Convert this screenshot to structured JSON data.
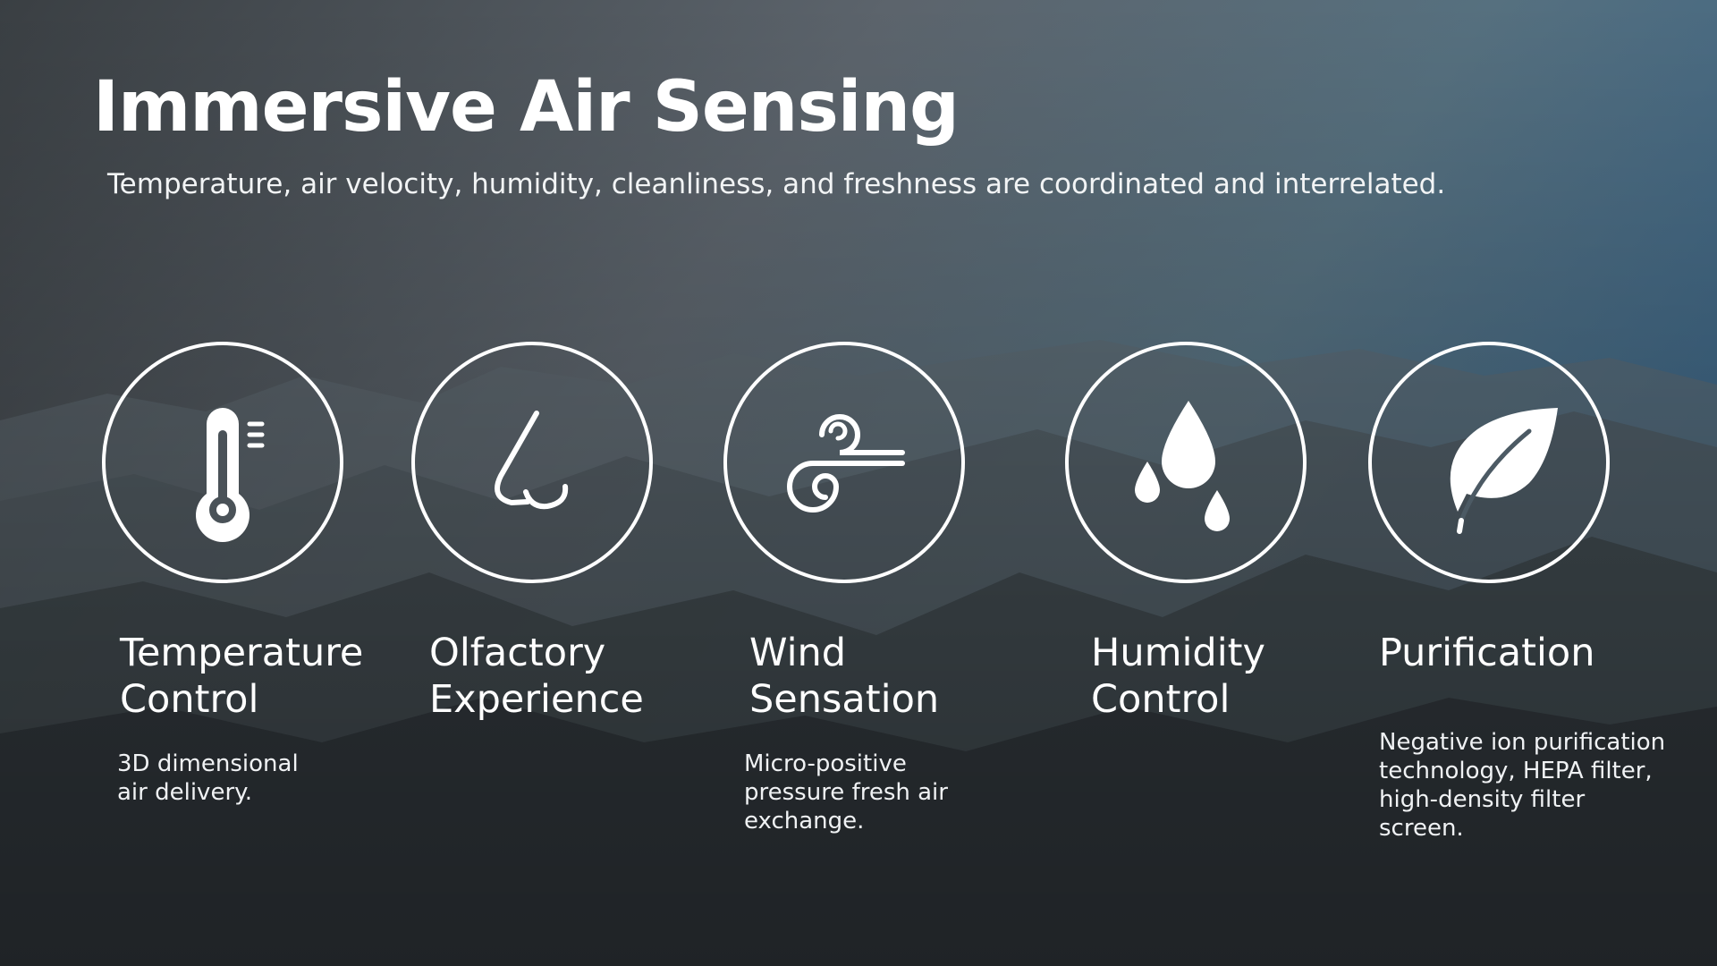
{
  "slide": {
    "title": "Immersive Air Sensing",
    "subtitle": "Temperature, air velocity, humidity, cleanliness, and freshness are coordinated and interrelated."
  },
  "features": [
    {
      "icon": "thermometer-icon",
      "label_line1": "Temperature",
      "label_line2": "Control",
      "desc_line1": "3D dimensional",
      "desc_line2": "air delivery."
    },
    {
      "icon": "nose-icon",
      "label_line1": "Olfactory",
      "label_line2": "Experience"
    },
    {
      "icon": "wind-icon",
      "label_line1": "Wind",
      "label_line2": "Sensation",
      "desc_line1": "Micro-positive",
      "desc_line2": "pressure fresh air",
      "desc_line3": "exchange."
    },
    {
      "icon": "water-drops-icon",
      "label_line1": "Humidity",
      "label_line2": "Control"
    },
    {
      "icon": "leaf-icon",
      "label_line1": "Purification",
      "desc_line1": "Negative ion purification",
      "desc_line2": "technology, HEPA filter,",
      "desc_line3": "high-density filter",
      "desc_line4": "screen."
    }
  ],
  "colors": {
    "text": "#ffffff",
    "icon_stroke": "#ffffff",
    "background_dark": "#3e4347",
    "background_sky": "#3d5c74"
  }
}
